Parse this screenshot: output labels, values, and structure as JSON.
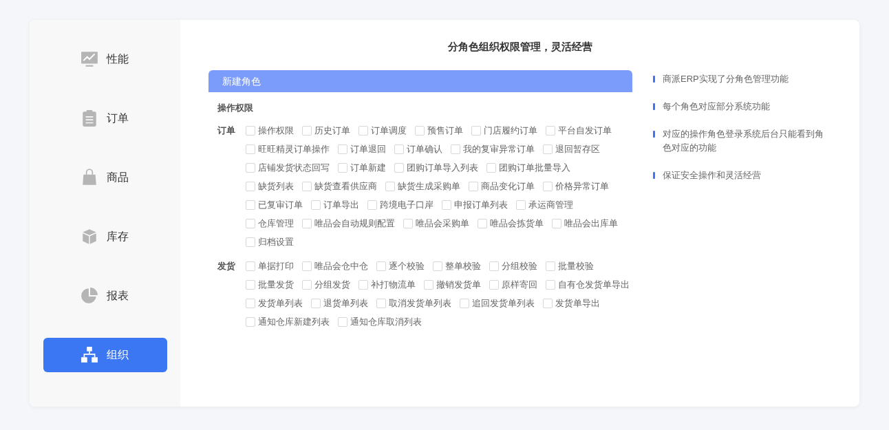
{
  "sidebar": {
    "items": [
      {
        "label": "性能",
        "kind": "chart",
        "selected": false
      },
      {
        "label": "订单",
        "kind": "clipboard",
        "selected": false
      },
      {
        "label": "商品",
        "kind": "bag",
        "selected": false
      },
      {
        "label": "库存",
        "kind": "cube",
        "selected": false
      },
      {
        "label": "报表",
        "kind": "pie",
        "selected": false
      },
      {
        "label": "组织",
        "kind": "org",
        "selected": true
      }
    ]
  },
  "title": "分角色组织权限管理，灵活经营",
  "panel": {
    "header": "新建角色",
    "section": "操作权限",
    "groups": [
      {
        "label": "订单",
        "lines": [
          [
            {
              "label": "操作权限",
              "checked": false
            },
            {
              "label": "历史订单",
              "checked": false
            },
            {
              "label": "订单调度",
              "checked": false
            },
            {
              "label": "预售订单",
              "checked": false
            },
            {
              "label": "门店履约订单",
              "checked": false
            },
            {
              "label": "平台自发订单",
              "checked": false
            }
          ],
          [
            {
              "label": "旺旺精灵订单操作",
              "checked": false
            },
            {
              "label": "订单退回",
              "checked": false
            },
            {
              "label": "订单确认",
              "checked": false
            },
            {
              "label": "我的复审异常订单",
              "checked": false
            },
            {
              "label": "退回暂存区",
              "checked": false
            }
          ],
          [
            {
              "label": "店铺发货状态回写",
              "checked": false
            },
            {
              "label": "订单新建",
              "checked": false
            },
            {
              "label": "团购订单导入列表",
              "checked": false
            },
            {
              "label": "团购订单批量导入",
              "checked": false
            }
          ],
          [
            {
              "label": "缺货列表",
              "checked": false
            },
            {
              "label": "缺货查看供应商",
              "checked": false
            },
            {
              "label": "缺货生成采购单",
              "checked": false
            },
            {
              "label": "商品变化订单",
              "checked": false
            },
            {
              "label": "价格异常订单",
              "checked": false
            }
          ],
          [
            {
              "label": "已复审订单",
              "checked": false
            },
            {
              "label": "订单导出",
              "checked": false
            },
            {
              "label": "跨境电子口岸",
              "checked": false
            },
            {
              "label": "申报订单列表",
              "checked": false
            },
            {
              "label": "承运商管理",
              "checked": false
            }
          ],
          [
            {
              "label": "仓库管理",
              "checked": false
            },
            {
              "label": "唯品会自动规则配置",
              "checked": false
            },
            {
              "label": "唯品会采购单",
              "checked": false
            },
            {
              "label": "唯品会拣货单",
              "checked": false
            },
            {
              "label": "唯品会出库单",
              "checked": false
            }
          ],
          [
            {
              "label": "归档设置",
              "checked": false
            }
          ]
        ]
      },
      {
        "label": "发货",
        "lines": [
          [
            {
              "label": "单据打印",
              "checked": false
            },
            {
              "label": "唯品会仓中仓",
              "checked": false
            },
            {
              "label": "逐个校验",
              "checked": false
            },
            {
              "label": "整单校验",
              "checked": false
            },
            {
              "label": "分组校验",
              "checked": false
            },
            {
              "label": "批量校验",
              "checked": false
            }
          ],
          [
            {
              "label": "批量发货",
              "checked": false
            },
            {
              "label": "分组发货",
              "checked": false
            },
            {
              "label": "补打物流单",
              "checked": false
            },
            {
              "label": "撤销发货单",
              "checked": false
            },
            {
              "label": "原样寄回",
              "checked": false
            },
            {
              "label": "自有仓发货单导出",
              "checked": false
            }
          ],
          [
            {
              "label": "发货单列表",
              "checked": false
            },
            {
              "label": "退货单列表",
              "checked": false
            },
            {
              "label": "取消发货单列表",
              "checked": false
            },
            {
              "label": "追回发货单列表",
              "checked": false
            },
            {
              "label": "发货单导出",
              "checked": false
            }
          ],
          [
            {
              "label": "通知仓库新建列表",
              "checked": false
            },
            {
              "label": "通知仓库取消列表",
              "checked": false
            }
          ]
        ]
      }
    ]
  },
  "notes": [
    "商派ERP实现了分角色管理功能",
    "每个角色对应部分系统功能",
    "对应的操作角色登录系统后台只能看到角色对应的功能",
    "保证安全操作和灵活经营"
  ]
}
